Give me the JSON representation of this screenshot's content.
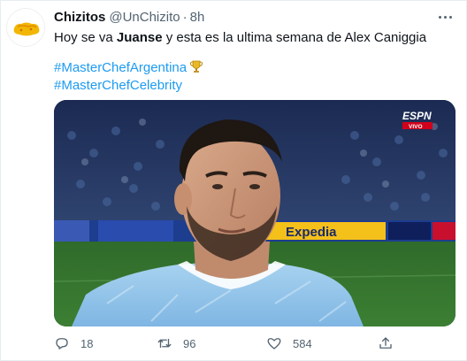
{
  "tweet": {
    "author_name": "Chizitos",
    "author_handle": "@UnChizito",
    "separator": "·",
    "time": "8h",
    "text_before": "Hoy se va ",
    "text_bold": "Juanse",
    "text_after": " y esta es la ultima semana de Alex Caniggia",
    "hashtags": [
      "#MasterChefArgentina",
      "#MasterChefCelebrity"
    ],
    "media": {
      "broadcaster_logo": "ESPN",
      "broadcaster_badge": "VIVO",
      "board_ads": [
        "Expedia"
      ]
    },
    "stats": {
      "replies": "18",
      "retweets": "96",
      "likes": "584"
    },
    "icons": {
      "more": "more-dots-icon",
      "reply": "reply-icon",
      "retweet": "retweet-icon",
      "like": "heart-icon",
      "share": "share-icon",
      "trophy": "trophy-icon"
    },
    "colors": {
      "link": "#1d9bf0",
      "muted": "#536471",
      "text": "#0f1419"
    }
  }
}
